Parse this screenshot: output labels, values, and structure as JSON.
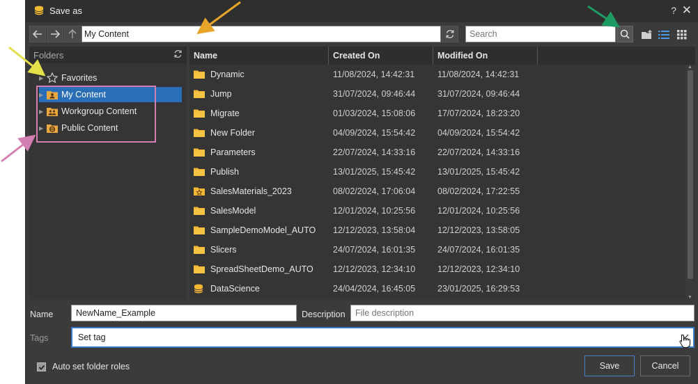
{
  "window": {
    "title": "Save as",
    "help": "?",
    "close": "✕"
  },
  "nav": {
    "path": "My Content",
    "search_placeholder": "Search"
  },
  "folders": {
    "header": "Folders",
    "items": [
      {
        "label": "Favorites",
        "icon": "star-icon"
      },
      {
        "label": "My Content",
        "icon": "user-folder-icon",
        "selected": true
      },
      {
        "label": "Workgroup Content",
        "icon": "group-folder-icon"
      },
      {
        "label": "Public Content",
        "icon": "globe-folder-icon"
      }
    ]
  },
  "files": {
    "columns": [
      "Name",
      "Created On",
      "Modified On"
    ],
    "rows": [
      {
        "name": "Dynamic",
        "created": "11/08/2024, 14:42:31",
        "modified": "11/08/2024, 14:42:31",
        "icon": "folder-icon"
      },
      {
        "name": "Jump",
        "created": "31/07/2024, 09:46:44",
        "modified": "31/07/2024, 09:46:44",
        "icon": "folder-icon"
      },
      {
        "name": "Migrate",
        "created": "01/03/2024, 15:08:06",
        "modified": "17/07/2024, 18:23:20",
        "icon": "folder-icon"
      },
      {
        "name": "New Folder",
        "created": "04/09/2024, 15:54:42",
        "modified": "04/09/2024, 15:54:42",
        "icon": "folder-icon"
      },
      {
        "name": "Parameters",
        "created": "22/07/2024, 14:33:16",
        "modified": "22/07/2024, 14:33:16",
        "icon": "folder-icon"
      },
      {
        "name": "Publish",
        "created": "13/01/2025, 15:45:42",
        "modified": "13/01/2025, 15:45:42",
        "icon": "folder-icon"
      },
      {
        "name": "SalesMaterials_2023",
        "created": "08/02/2024, 17:06:04",
        "modified": "08/02/2024, 17:22:55",
        "icon": "star-folder-icon"
      },
      {
        "name": "SalesModel",
        "created": "12/01/2024, 10:25:56",
        "modified": "12/01/2024, 10:25:56",
        "icon": "folder-icon"
      },
      {
        "name": "SampleDemoModel_AUTO",
        "created": "12/12/2023, 13:58:04",
        "modified": "12/12/2023, 13:58:05",
        "icon": "folder-icon"
      },
      {
        "name": "Slicers",
        "created": "24/07/2024, 16:01:35",
        "modified": "24/07/2024, 16:01:35",
        "icon": "folder-icon"
      },
      {
        "name": "SpreadSheetDemo_AUTO",
        "created": "12/12/2023, 12:34:10",
        "modified": "12/12/2023, 12:34:10",
        "icon": "folder-icon"
      },
      {
        "name": "DataScience",
        "created": "24/04/2024, 16:45:05",
        "modified": "23/01/2025, 16:29:53",
        "icon": "database-icon"
      }
    ]
  },
  "form": {
    "name_label": "Name",
    "name_value": "NewName_Example",
    "description_label": "Description",
    "description_placeholder": "File description",
    "tags_label": "Tags",
    "tags_value": "Set tag",
    "auto_roles_label": "Auto set folder roles",
    "auto_roles_checked": true,
    "save_label": "Save",
    "cancel_label": "Cancel"
  },
  "colors": {
    "accent": "#2a6eb7",
    "folder": "#f2b733",
    "arrow_orange": "#e9a52a",
    "arrow_green": "#1e9a63",
    "arrow_yellow": "#e3e04a",
    "arrow_pink": "#d47fb1"
  }
}
